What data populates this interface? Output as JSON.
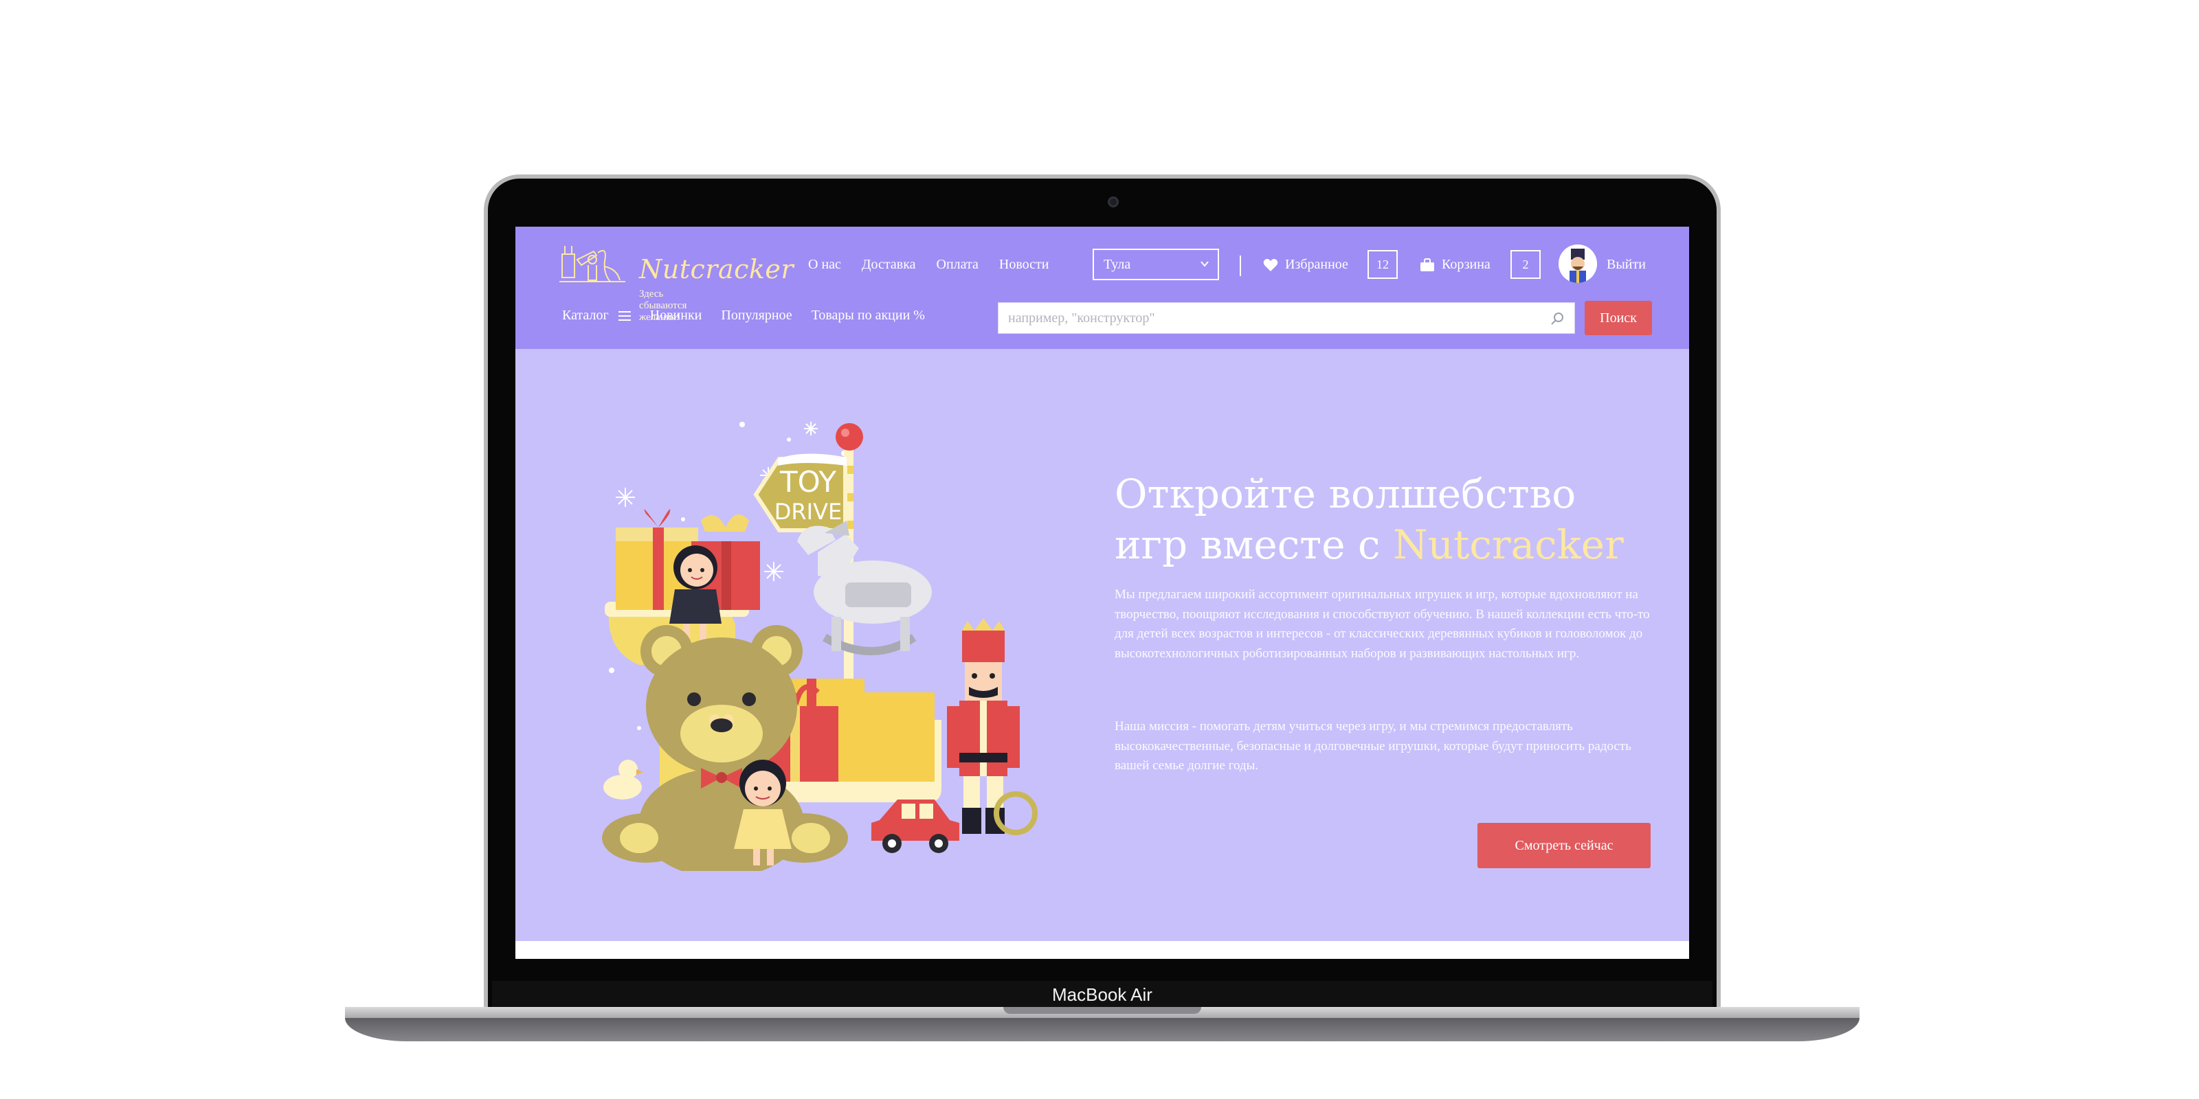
{
  "device": {
    "model_label": "MacBook Air"
  },
  "header": {
    "brand": "Nutcracker",
    "tagline": "Здесь сбываются желания!",
    "nav": [
      "О нас",
      "Доставка",
      "Оплата",
      "Новости"
    ],
    "city_select": {
      "selected": "Тула"
    },
    "favorites": {
      "label": "Избранное",
      "count": "12"
    },
    "cart": {
      "label": "Корзина",
      "count": "2"
    },
    "logout_label": "Выйти"
  },
  "subnav": {
    "catalog_label": "Каталог",
    "links": [
      "Новинки",
      "Популярное",
      "Товары по акции %"
    ],
    "search": {
      "placeholder": "например, \"конструктор\"",
      "value": ""
    },
    "search_button": "Поиск"
  },
  "hero": {
    "headline_line1": "Откройте волшебство",
    "headline_line2_prefix": "игр вместе с ",
    "headline_accent": "Nutcracker",
    "paragraph1": "Мы предлагаем широкий ассортимент оригинальных игрушек и игр, которые вдохновляют на творчество, поощряют исследования и способствуют обучению. В нашей коллекции есть что-то для детей всех возрастов и интересов - от классических деревянных кубиков и головоломок до высокотехнологичных роботизированных наборов и развивающих настольных игр.",
    "paragraph2": "Наша миссия - помогать детям учиться через игру, и мы стремимся предоставлять высококачественные, безопасные и долговечные игрушки, которые будут приносить радость вашей семье долгие годы.",
    "cta_label": "Смотреть сейчас",
    "illustration": {
      "sign_line1": "TOY",
      "sign_line2": "DRIVE"
    }
  },
  "colors": {
    "header_bg": "#9e8df4",
    "hero_bg": "#c8c0fb",
    "accent_yellow": "#fde8a0",
    "button_red": "#e05a5e"
  }
}
